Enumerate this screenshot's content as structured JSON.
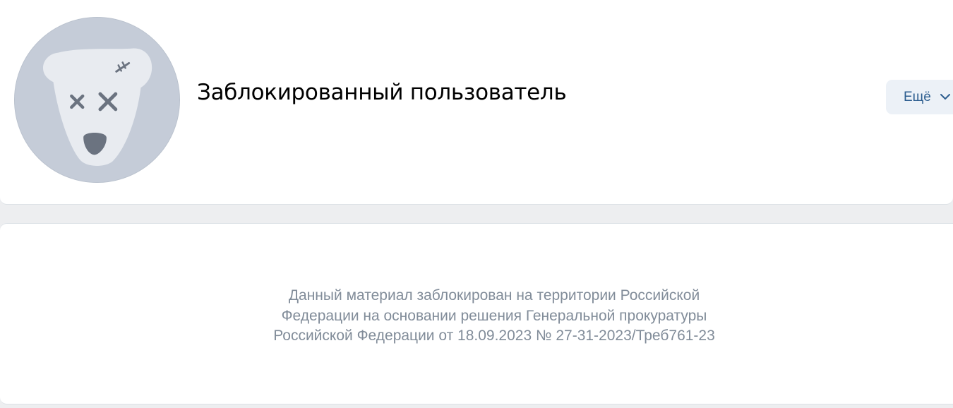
{
  "profile": {
    "name": "Заблокированный пользователь",
    "avatar_icon": "blocked-dog-icon"
  },
  "actions": {
    "more_label": "Ещё",
    "more_icon": "chevron-down-icon"
  },
  "notice": {
    "lines": [
      "Данный материал заблокирован на территории Российской",
      "Федерации на основании решения Генеральной прокуратуры",
      "Российской Федерации от 18.09.2023 № 27-31-2023/Треб761-23"
    ]
  },
  "colors": {
    "background": "#edeef0",
    "card": "#ffffff",
    "avatar_bg": "#c5ccd8",
    "notice_text": "#818c99",
    "button_bg": "#ecf1f7",
    "button_text": "#2c5d8f"
  }
}
